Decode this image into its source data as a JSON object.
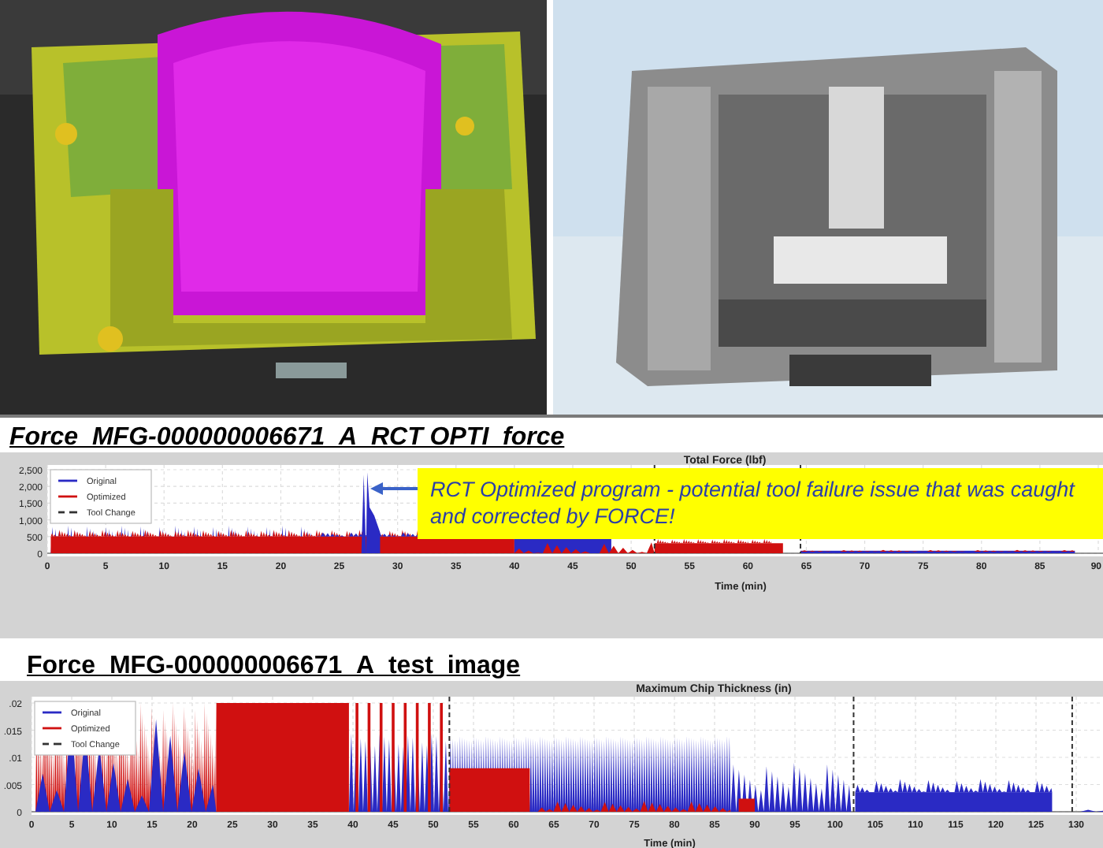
{
  "charts": [
    {
      "heading": "Force_MFG-000000006671_A_RCT OPTI_force",
      "heading_italic": true,
      "title": "Total Force (lbf)",
      "xlabel": "Time (min)",
      "yticks": [
        "2,500",
        "2,000",
        "1,500",
        "1,000",
        "500",
        "0"
      ],
      "xticks": [
        "0",
        "5",
        "10",
        "15",
        "20",
        "25",
        "30",
        "35",
        "40",
        "45",
        "50",
        "55",
        "60",
        "65",
        "70",
        "75",
        "80",
        "85",
        "90"
      ],
      "legend": [
        {
          "label": "Original",
          "color": "#2a2ac4",
          "kind": "line"
        },
        {
          "label": "Optimized",
          "color": "#d01010",
          "kind": "line"
        },
        {
          "label": "Tool Change",
          "color": "#333333",
          "kind": "dashed"
        }
      ],
      "callout": "RCT Optimized program - potential tool failure issue that was caught and corrected by FORCE!"
    },
    {
      "heading": "Force_MFG-000000006671_A_test_image",
      "heading_italic": false,
      "title": "Maximum Chip Thickness (in)",
      "xlabel": "Time (min)",
      "yticks": [
        ".02",
        ".015",
        ".01",
        ".005",
        "0"
      ],
      "xticks": [
        "0",
        "5",
        "10",
        "15",
        "20",
        "25",
        "30",
        "35",
        "40",
        "45",
        "50",
        "55",
        "60",
        "65",
        "70",
        "75",
        "80",
        "85",
        "90",
        "95",
        "100",
        "105",
        "110",
        "115",
        "120",
        "125",
        "130"
      ],
      "legend": [
        {
          "label": "Original",
          "color": "#2a2ac4",
          "kind": "line"
        },
        {
          "label": "Optimized",
          "color": "#d01010",
          "kind": "line"
        },
        {
          "label": "Tool Change",
          "color": "#333333",
          "kind": "dashed"
        }
      ]
    }
  ]
}
